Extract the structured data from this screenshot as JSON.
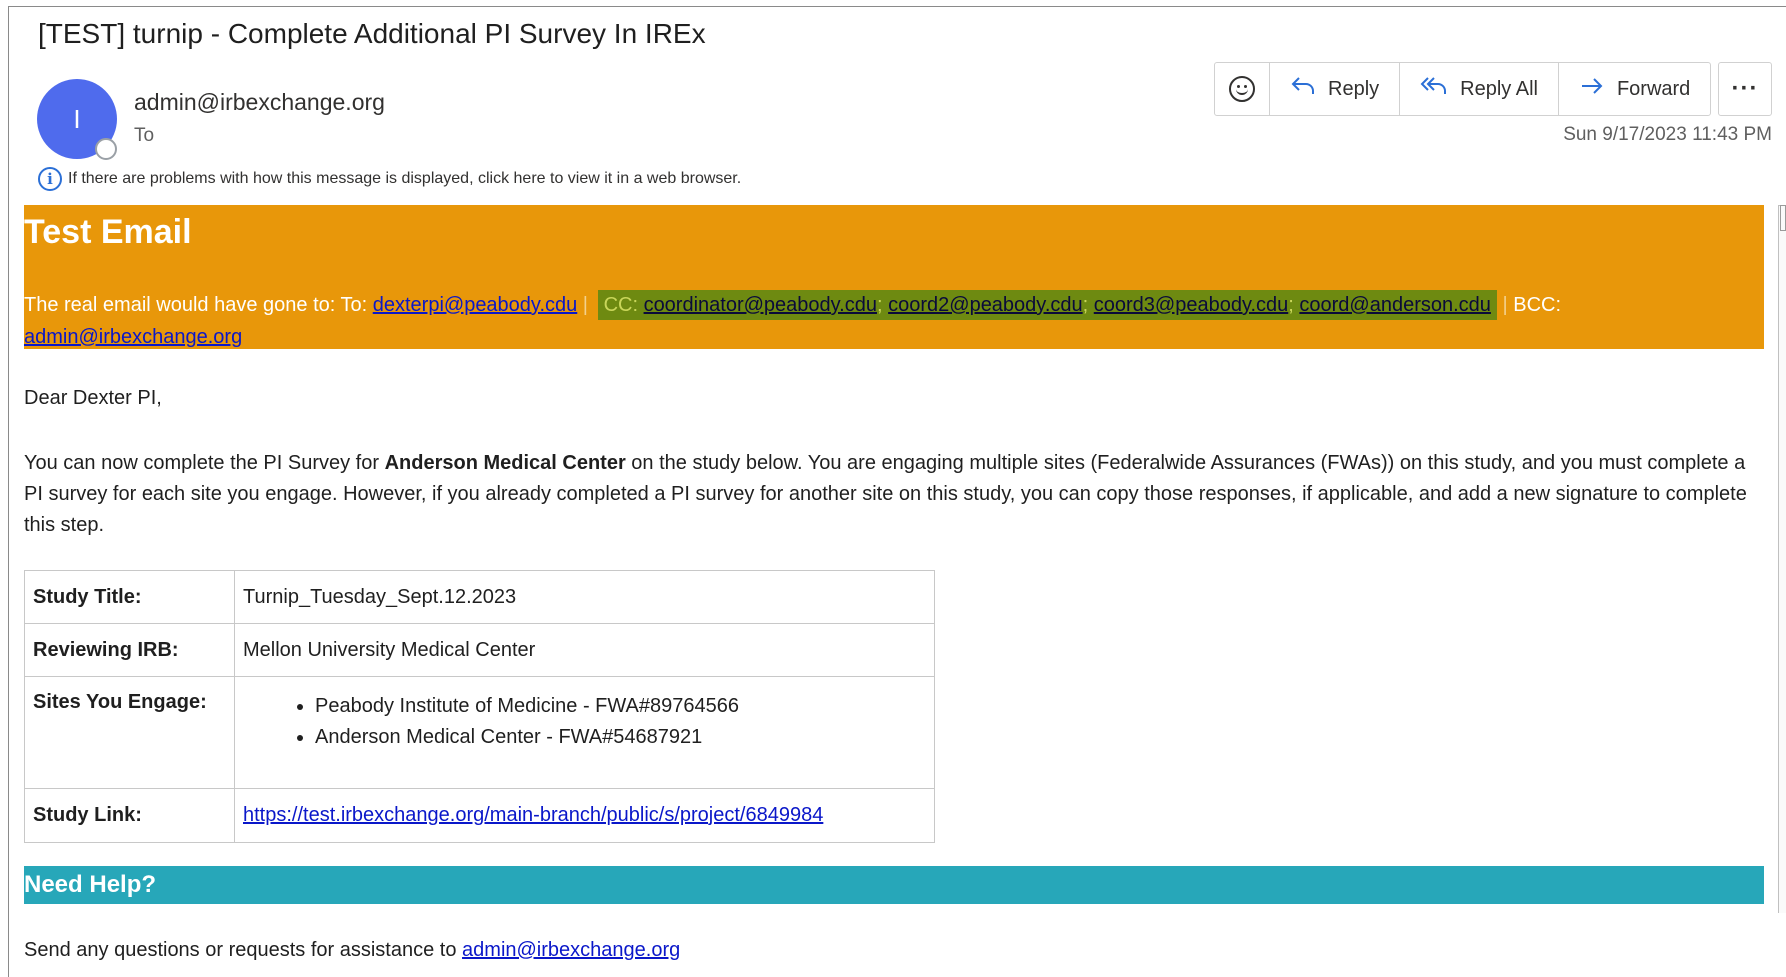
{
  "message": {
    "subject": "[TEST] turnip - Complete Additional PI Survey In IREx",
    "sender": "admin@irbexchange.org",
    "avatar_initial": "I",
    "to_label": "To",
    "date": "Sun 9/17/2023 11:43 PM",
    "info_text": "If there are problems with how this message is displayed, click here to view it in a web browser."
  },
  "actions": {
    "reply": "Reply",
    "reply_all": "Reply All",
    "forward": "Forward",
    "more": "···"
  },
  "banner": {
    "title": "Test Email",
    "intro": "The real email would have gone to: To: ",
    "to_email": "dexterpi@peabody.cdu",
    "sep1": " | ",
    "cc_label": "CC: ",
    "cc_emails": [
      "coordinator@peabody.cdu",
      "coord2@peabody.cdu",
      "coord3@peabody.cdu",
      "coord@anderson.cdu"
    ],
    "cc_sep": "; ",
    "sep2": " | ",
    "bcc_label": "BCC: ",
    "bcc_email": "admin@irbexchange.org"
  },
  "body": {
    "greeting": "Dear Dexter PI,",
    "para_pre": "You can now complete the PI Survey for ",
    "para_bold": "Anderson Medical Center",
    "para_post": " on the study below. You are engaging multiple sites (Federalwide Assurances (FWAs)) on this study, and you must complete a PI survey for each site you engage. However, if you already completed a PI survey for another site on this study, you can copy those responses, if applicable, and add a new signature to complete this step."
  },
  "study": {
    "title_label": "Study Title:",
    "title_value": "Turnip_Tuesday_Sept.12.2023",
    "irb_label": "Reviewing IRB:",
    "irb_value": "Mellon University Medical Center",
    "sites_label": "Sites You Engage:",
    "sites": [
      "Peabody Institute of Medicine - FWA#89764566",
      "Anderson Medical Center - FWA#54687921"
    ],
    "link_label": "Study Link:",
    "link_value": "https://test.irbexchange.org/main-branch/public/s/project/6849984"
  },
  "help": {
    "title": "Need Help?",
    "line_pre": "Send any questions or requests for assistance to ",
    "email": "admin@irbexchange.org"
  },
  "colors": {
    "banner": "#e8970a",
    "help_bar": "#27a7b9",
    "avatar": "#4f6bed",
    "link": "#0a17c9",
    "cc_highlight": "#6e8a11"
  }
}
